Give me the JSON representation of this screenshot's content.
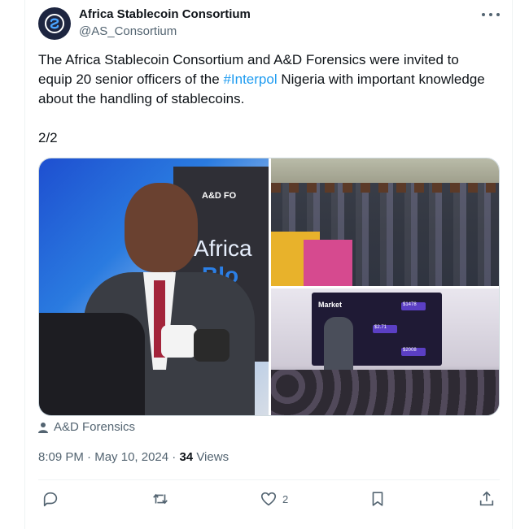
{
  "tweet": {
    "author_name": "Africa Stablecoin Consortium",
    "author_handle": "@AS_Consortium",
    "text_before": "The Africa Stablecoin Consortium and A&D Forensics were invited to equip 20 senior officers of the ",
    "hashtag": "#Interpol",
    "text_after": " Nigeria with important knowledge about the handling of stablecoins.",
    "page_indicator": "2/2",
    "media_credit": "A&D Forensics",
    "time": "8:09 PM",
    "date": "May 10, 2024",
    "separator": "·",
    "views_count": "34",
    "views_label": "Views",
    "like_count": "2"
  },
  "media": {
    "banner_logo": "A&D FO",
    "banner_word1": "Africa",
    "banner_word2": "Blo",
    "screen_title": "Market",
    "screen_values": [
      "$1478",
      "$2.71",
      "$2008"
    ]
  },
  "colors": {
    "accent": "#1d9bf0",
    "text_primary": "#0f1419",
    "text_secondary": "#536471",
    "avatar_bg": "#1d2540",
    "border": "#cfd9de"
  },
  "icons": {
    "more": "more-horizontal-icon",
    "credit": "person-icon",
    "reply": "reply-icon",
    "repost": "repost-icon",
    "like": "heart-icon",
    "bookmark": "bookmark-icon",
    "share": "share-icon"
  }
}
